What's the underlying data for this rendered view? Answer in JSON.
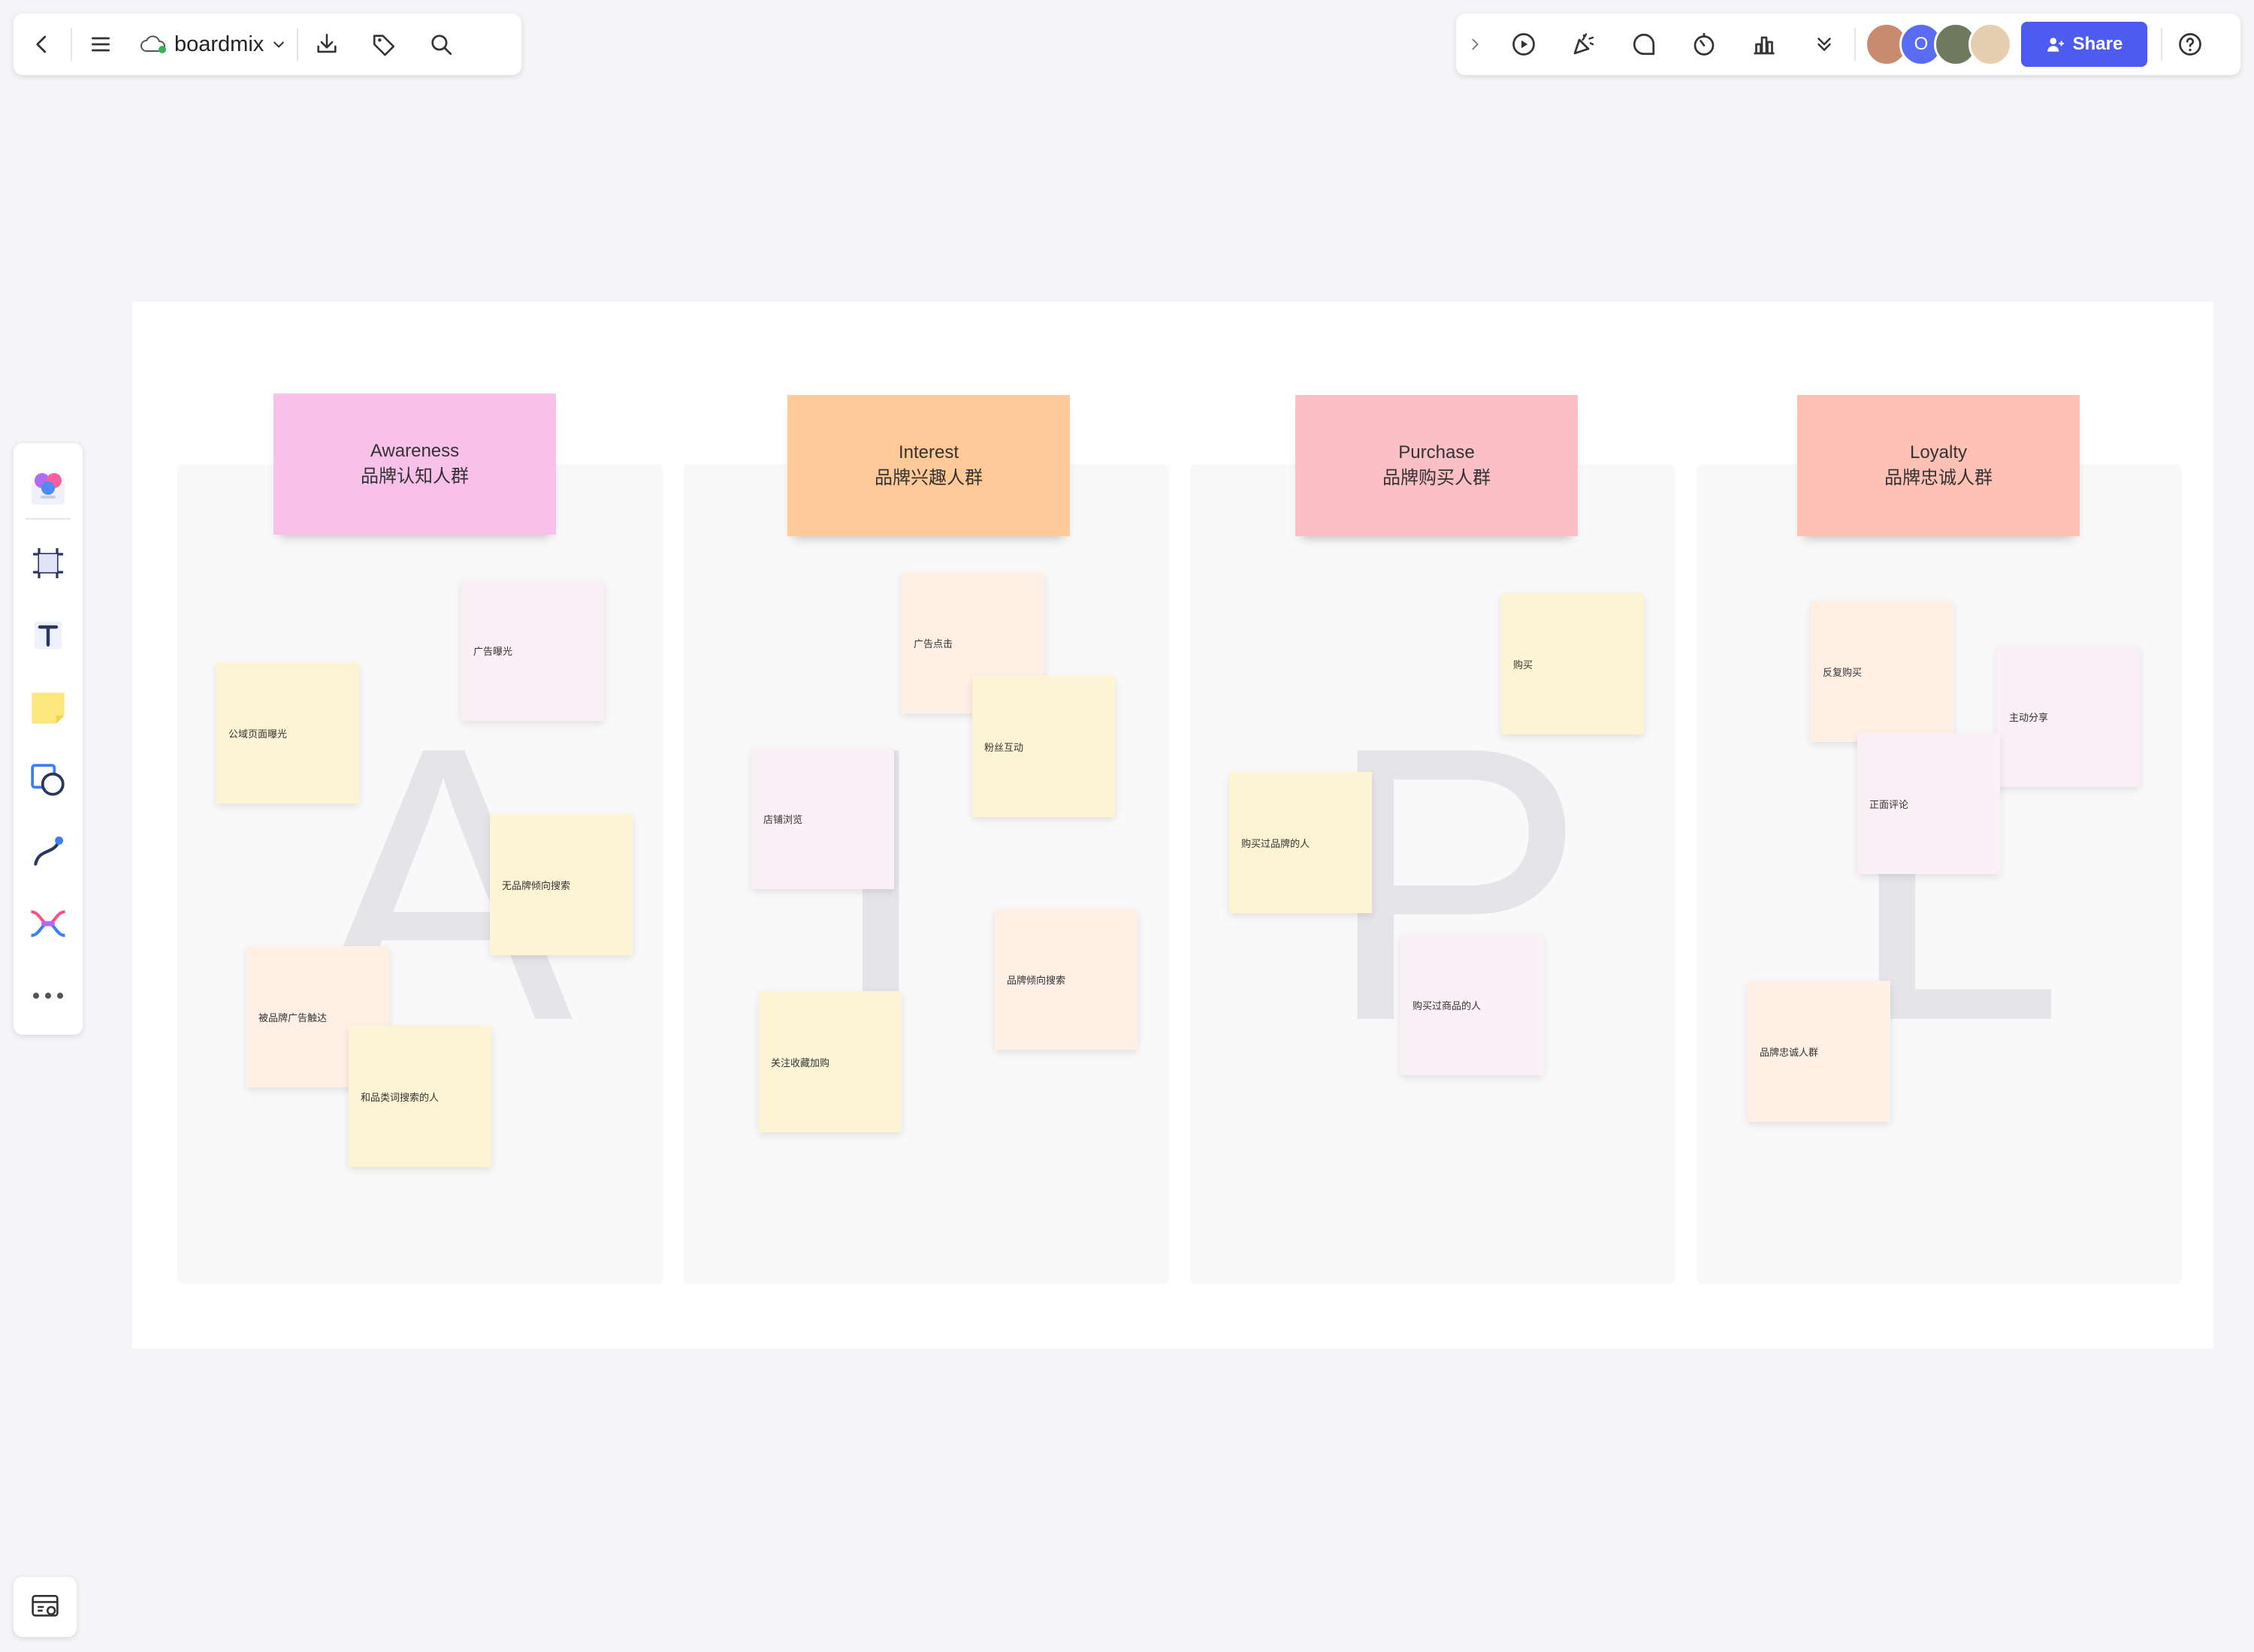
{
  "app": {
    "brand_name": "boardmix"
  },
  "share": {
    "label": "Share"
  },
  "avatar_overflow": "O",
  "columns": [
    {
      "title_en": "Awareness",
      "title_cn": "品牌认知人群",
      "letter": "A",
      "color": "#f7c1ea",
      "notes": [
        "广告曝光",
        "公域页面曝光",
        "无品牌倾向搜索",
        "被品牌广告触达",
        "和品类词搜索的人"
      ]
    },
    {
      "title_en": "Interest",
      "title_cn": "品牌兴趣人群",
      "letter": "I",
      "color": "#ffc998",
      "notes": [
        "广告点击",
        "粉丝互动",
        "店铺浏览",
        "品牌倾向搜索",
        "关注收藏加购"
      ]
    },
    {
      "title_en": "Purchase",
      "title_cn": "品牌购买人群",
      "letter": "P",
      "color": "#fbbfc6",
      "notes": [
        "购买",
        "购买过品牌的人",
        "购买过商品的人"
      ]
    },
    {
      "title_en": "Loyalty",
      "title_cn": "品牌忠诚人群",
      "letter": "L",
      "color": "#ffc1b6",
      "notes": [
        "反复购买",
        "主动分享",
        "正面评论",
        "品牌忠诚人群"
      ]
    }
  ],
  "colors": {
    "accent": "#4d5bf0",
    "note_yellow": "#fdf4d4",
    "note_pink": "#faf0f6",
    "note_orange": "#fef0e4"
  }
}
